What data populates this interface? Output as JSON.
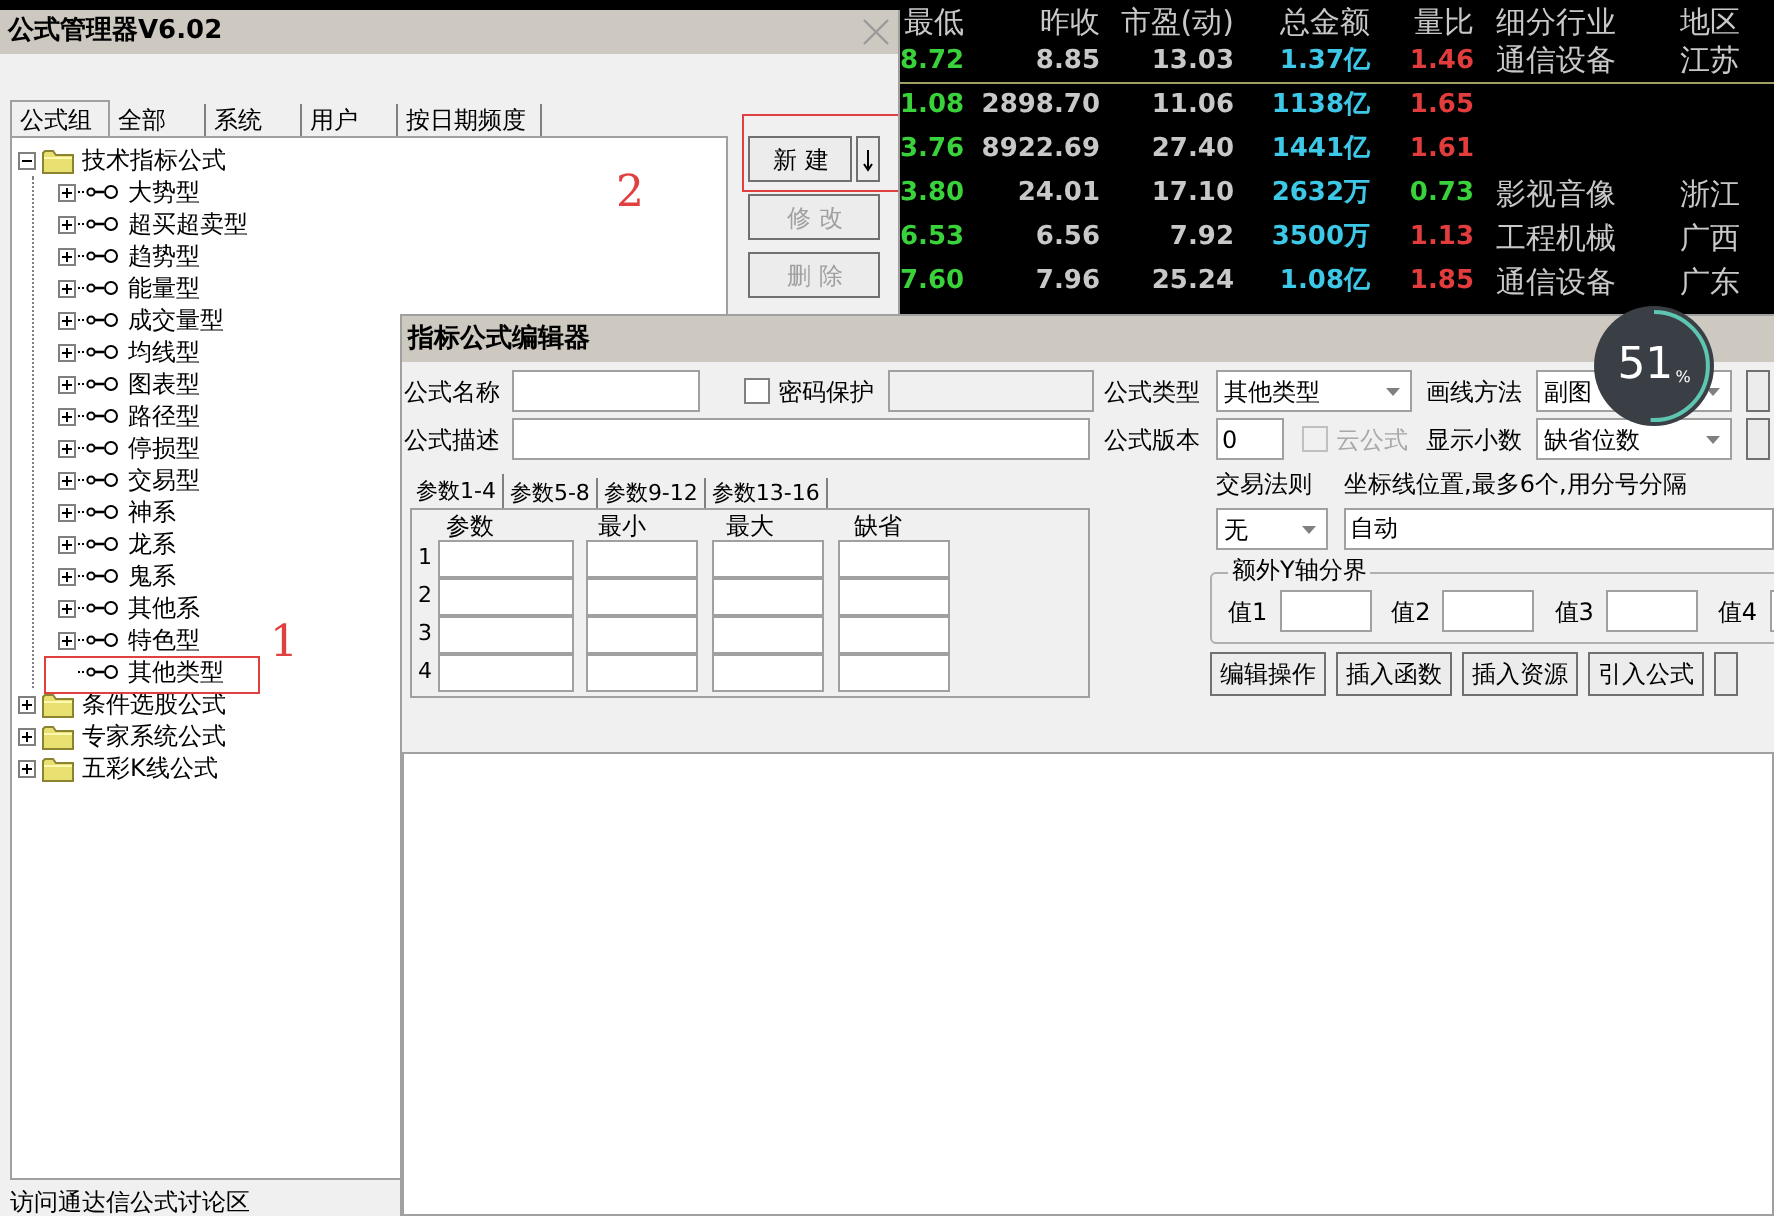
{
  "stock_table": {
    "columns": [
      "最低",
      "昨收",
      "市盈(动)",
      "总金额",
      "量比",
      "细分行业",
      "地区"
    ],
    "rows": [
      {
        "low": "8.72",
        "prev_close": "8.85",
        "pe": "13.03",
        "amount": "1.37亿",
        "ratio": "1.46",
        "ratio_up": true,
        "industry": "通信设备",
        "region": "江苏"
      },
      {
        "low": "1.08",
        "prev_close": "2898.70",
        "pe": "11.06",
        "amount": "1138亿",
        "ratio": "1.65",
        "ratio_up": true
      },
      {
        "low": "3.76",
        "prev_close": "8922.69",
        "pe": "27.40",
        "amount": "1441亿",
        "ratio": "1.61",
        "ratio_up": true
      },
      {
        "low": "3.80",
        "prev_close": "24.01",
        "pe": "17.10",
        "amount": "2632万",
        "ratio": "0.73",
        "ratio_up": false,
        "industry": "影视音像",
        "region": "浙江"
      },
      {
        "low": "6.53",
        "prev_close": "6.56",
        "pe": "7.92",
        "amount": "3500万",
        "ratio": "1.13",
        "ratio_up": true,
        "industry": "工程机械",
        "region": "广西"
      },
      {
        "low": "7.60",
        "prev_close": "7.96",
        "pe": "25.24",
        "amount": "1.08亿",
        "ratio": "1.85",
        "ratio_up": true,
        "industry": "通信设备",
        "region": "广东"
      }
    ]
  },
  "manager": {
    "title": "公式管理器V6.02",
    "tabs": [
      {
        "label": "公式组",
        "selected": true
      },
      {
        "label": "全部",
        "selected": false
      },
      {
        "label": "系统",
        "selected": false
      },
      {
        "label": "用户",
        "selected": false
      },
      {
        "label": "按日期频度",
        "selected": false
      }
    ],
    "tree": [
      {
        "label": "技术指标公式",
        "expanded": true,
        "children": [
          {
            "label": "大势型",
            "expandable": true
          },
          {
            "label": "超买超卖型",
            "expandable": true
          },
          {
            "label": "趋势型",
            "expandable": true
          },
          {
            "label": "能量型",
            "expandable": true
          },
          {
            "label": "成交量型",
            "expandable": true
          },
          {
            "label": "均线型",
            "expandable": true
          },
          {
            "label": "图表型",
            "expandable": true
          },
          {
            "label": "路径型",
            "expandable": true
          },
          {
            "label": "停损型",
            "expandable": true
          },
          {
            "label": "交易型",
            "expandable": true
          },
          {
            "label": "神系",
            "expandable": true
          },
          {
            "label": "龙系",
            "expandable": true
          },
          {
            "label": "鬼系",
            "expandable": true
          },
          {
            "label": "其他系",
            "expandable": true
          },
          {
            "label": "特色型",
            "expandable": true
          },
          {
            "label": "其他类型",
            "expandable": false
          }
        ]
      },
      {
        "label": "条件选股公式",
        "expanded": false
      },
      {
        "label": "专家系统公式",
        "expanded": false
      },
      {
        "label": "五彩K线公式",
        "expanded": false
      }
    ],
    "buttons": [
      {
        "label": "新 建",
        "disabled": false
      },
      {
        "label": "修 改",
        "disabled": true
      },
      {
        "label": "删 除",
        "disabled": true
      }
    ],
    "status_link": "访问通达信公式讨论区",
    "annotations": [
      {
        "label": "2"
      },
      {
        "label": "1"
      }
    ]
  },
  "editor": {
    "title": "指标公式编辑器",
    "name_label": "公式名称",
    "password": {
      "label": "密码保护",
      "checked": false
    },
    "desc_label": "公式描述",
    "formula_type": {
      "label": "公式类型",
      "value": "其他类型"
    },
    "draw_method": {
      "label": "画线方法",
      "value": "副图"
    },
    "version": {
      "label": "公式版本",
      "value": "0"
    },
    "cloud": {
      "label": "云公式",
      "checked": false,
      "disabled": true
    },
    "decimals": {
      "label": "显示小数",
      "value": "缺省位数"
    },
    "param_tabs": [
      {
        "label": "参数1-4",
        "selected": true
      },
      {
        "label": "参数5-8",
        "selected": false
      },
      {
        "label": "参数9-12",
        "selected": false
      },
      {
        "label": "参数13-16",
        "selected": false
      }
    ],
    "param_columns": [
      "参数",
      "最小",
      "最大",
      "缺省"
    ],
    "param_rows": [
      "1",
      "2",
      "3",
      "4"
    ],
    "trade_rule": {
      "label": "交易法则",
      "value": "无"
    },
    "axis": {
      "label": "坐标线位置,最多6个,用分号分隔",
      "value": "自动"
    },
    "y_axis_group": {
      "title": "额外Y轴分界",
      "fields": [
        "值1",
        "值2",
        "值3",
        "值4"
      ]
    },
    "buttons": [
      "编辑操作",
      "插入函数",
      "插入资源",
      "引入公式"
    ]
  },
  "monitor_widget": {
    "value": "51",
    "unit": "%",
    "level": 0.51
  }
}
